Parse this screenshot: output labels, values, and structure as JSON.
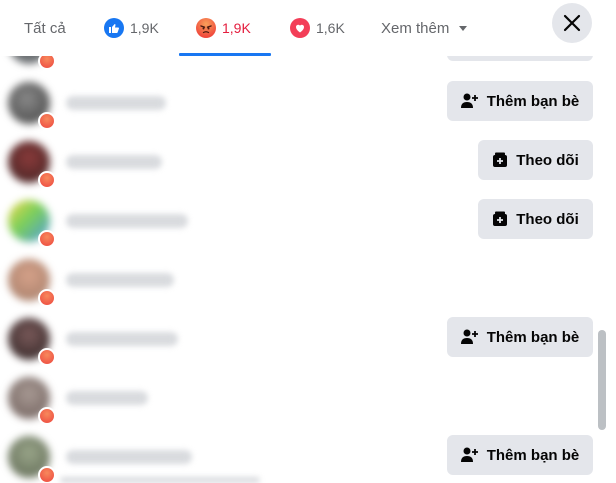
{
  "tabs": {
    "all": {
      "label": "Tất cả"
    },
    "like": {
      "count": "1,9K",
      "icon": "like-icon",
      "color": "#1877f2"
    },
    "angry": {
      "count": "1,9K",
      "icon": "angry-icon",
      "color": "#e41e3f"
    },
    "love": {
      "count": "1,6K",
      "icon": "love-icon",
      "color": "#f33e58"
    },
    "more": {
      "label": "Xem thêm",
      "icon": "caret-down-icon"
    }
  },
  "close": {
    "icon": "close-icon"
  },
  "rows": [
    {
      "action": ""
    },
    {
      "action": "Thêm bạn bè"
    },
    {
      "action": "Theo dõi"
    },
    {
      "action": "Theo dõi"
    },
    {
      "action": ""
    },
    {
      "action": "Thêm bạn bè"
    },
    {
      "action": ""
    },
    {
      "action": "Thêm bạn bè"
    }
  ],
  "colors": {
    "accent": "#1877f2",
    "angry": "#e41e3f",
    "button_bg": "#e4e6eb"
  }
}
